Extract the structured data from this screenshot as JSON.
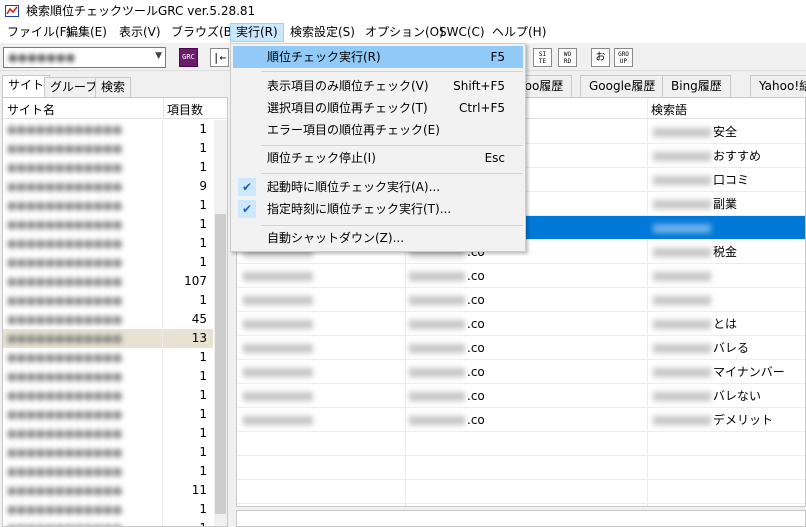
{
  "title": "検索順位チェックツールGRC  ver.5.28.81",
  "menu": [
    {
      "label": "ファイル(F)"
    },
    {
      "label": "編集(E)"
    },
    {
      "label": "表示(V)"
    },
    {
      "label": "ブラウズ(B)"
    },
    {
      "label": "実行(R)"
    },
    {
      "label": "検索設定(S)"
    },
    {
      "label": "オプション(O)"
    },
    {
      "label": "SWC(C)"
    },
    {
      "label": "ヘルプ(H)"
    }
  ],
  "toolbar": {
    "site_combo_value": "●●●●●●●",
    "grc_label": "GRC",
    "si_label": "SI TE",
    "wo_label": "WO RD",
    "o_label": "お",
    "gro_label": "GRO UP"
  },
  "left_tabs": [
    {
      "label": "サイト"
    },
    {
      "label": "グループ"
    },
    {
      "label": "検索"
    }
  ],
  "site_list": {
    "headers": {
      "name": "サイト名",
      "count": "項目数"
    },
    "rows": [
      {
        "name": "●●●●●●●●●●●●",
        "count": "1"
      },
      {
        "name": "●●●●●●●●●●●●",
        "count": "1"
      },
      {
        "name": "●●●●●●●●●●●●",
        "count": "1"
      },
      {
        "name": "●●●●●●●●●●●●",
        "count": "9"
      },
      {
        "name": "●●●●●●●●●●●●",
        "count": "1"
      },
      {
        "name": "●●●●●●●●●●●●",
        "count": "1"
      },
      {
        "name": "●●●●●●●●●●●●",
        "count": "1"
      },
      {
        "name": "●●●●●●●●●●●●",
        "count": "1"
      },
      {
        "name": "●●●●●●●●●●●●",
        "count": "107"
      },
      {
        "name": "●●●●●●●●●●●●",
        "count": "1"
      },
      {
        "name": "●●●●●●●●●●●●",
        "count": "45"
      },
      {
        "name": "●●●●●●●●●●●●",
        "count": "13"
      },
      {
        "name": "●●●●●●●●●●●●",
        "count": "1"
      },
      {
        "name": "●●●●●●●●●●●●",
        "count": "1"
      },
      {
        "name": "●●●●●●●●●●●●",
        "count": "1"
      },
      {
        "name": "●●●●●●●●●●●●",
        "count": "1"
      },
      {
        "name": "●●●●●●●●●●●●",
        "count": "1"
      },
      {
        "name": "●●●●●●●●●●●●",
        "count": "1"
      },
      {
        "name": "●●●●●●●●●●●●",
        "count": "1"
      },
      {
        "name": "●●●●●●●●●●●●",
        "count": "11"
      },
      {
        "name": "●●●●●●●●●●●●",
        "count": "1"
      },
      {
        "name": "●●●●●●●●●●●●",
        "count": "1"
      }
    ]
  },
  "right_tabs": [
    {
      "label": "hoo履歴"
    },
    {
      "label": "Google履歴"
    },
    {
      "label": "Bing履歴"
    },
    {
      "label": "Yahoo!結"
    }
  ],
  "grid": {
    "keyword_header": "検索語",
    "rows": [
      {
        "url": "",
        "keyword": "安全"
      },
      {
        "url": "",
        "keyword": "おすすめ"
      },
      {
        "url": "",
        "keyword": "口コミ"
      },
      {
        "url": "",
        "keyword": "副業"
      },
      {
        "url": "",
        "keyword": ""
      },
      {
        "url": ".co",
        "keyword": "税金"
      },
      {
        "url": ".co",
        "keyword": ""
      },
      {
        "url": ".co",
        "keyword": ""
      },
      {
        "url": ".co",
        "keyword": "とは"
      },
      {
        "url": ".co",
        "keyword": "バレる"
      },
      {
        "url": ".co",
        "keyword": "マイナンバー"
      },
      {
        "url": ".co",
        "keyword": "バレない"
      },
      {
        "url": ".co",
        "keyword": "デメリット"
      },
      {
        "url": "",
        "keyword": ""
      },
      {
        "url": "",
        "keyword": ""
      },
      {
        "url": "",
        "keyword": ""
      }
    ]
  },
  "dropdown": {
    "items": [
      {
        "label": "順位チェック実行(R)",
        "shortcut": "F5"
      },
      {
        "label": "表示項目のみ順位チェック(V)",
        "shortcut": "Shift+F5"
      },
      {
        "label": "選択項目の順位再チェック(T)",
        "shortcut": "Ctrl+F5"
      },
      {
        "label": "エラー項目の順位再チェック(E)",
        "shortcut": ""
      },
      {
        "label": "順位チェック停止(I)",
        "shortcut": "Esc"
      },
      {
        "label": "起動時に順位チェック実行(A)...",
        "shortcut": ""
      },
      {
        "label": "指定時刻に順位チェック実行(T)...",
        "shortcut": ""
      },
      {
        "label": "自動シャットダウン(Z)...",
        "shortcut": ""
      }
    ]
  }
}
